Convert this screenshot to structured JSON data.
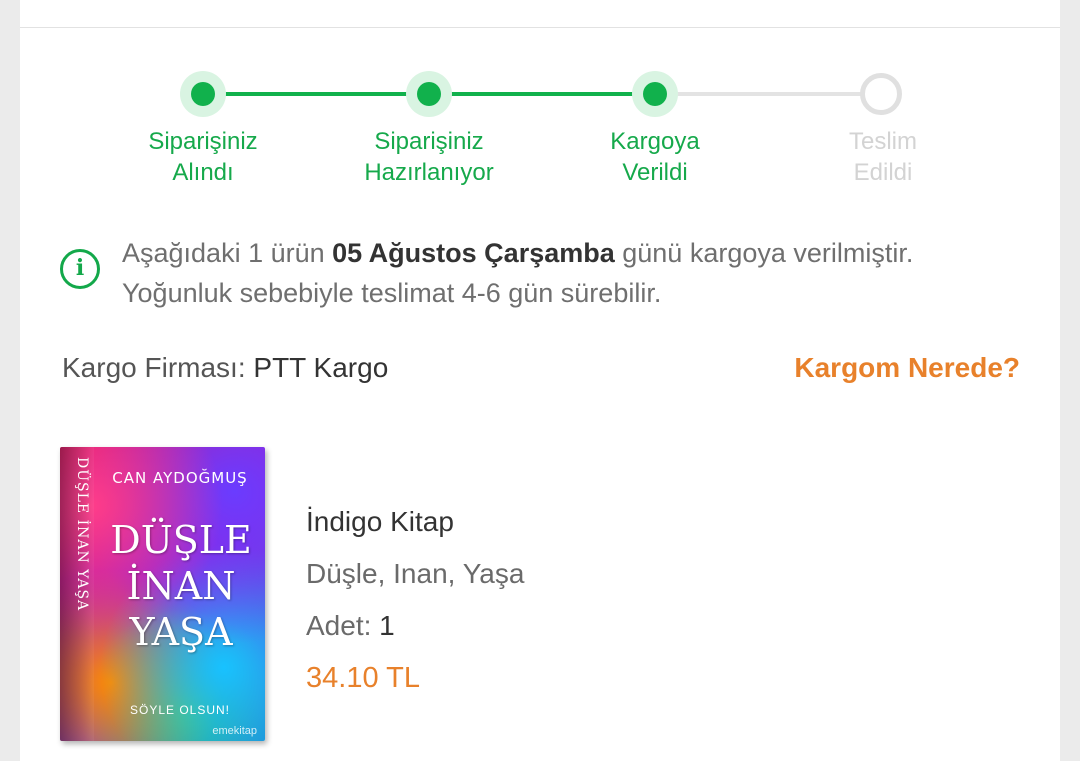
{
  "colors": {
    "accent_green": "#11b14c",
    "accent_orange": "#e8812b",
    "pending_gray": "#d3d3d3"
  },
  "progress": {
    "steps": [
      {
        "line1": "Siparişiniz",
        "line2": "Alındı",
        "status": "done"
      },
      {
        "line1": "Siparişiniz",
        "line2": "Hazırlanıyor",
        "status": "done"
      },
      {
        "line1": "Kargoya",
        "line2": "Verildi",
        "status": "done"
      },
      {
        "line1": "Teslim",
        "line2": "Edildi",
        "status": "pending"
      }
    ]
  },
  "info": {
    "icon": "info-icon",
    "icon_glyph": "i",
    "prefix": "Aşağıdaki 1 ürün ",
    "date": "05 Ağustos Çarşamba",
    "suffix": " günü kargoya verilmiştir.",
    "line2": "Yoğunluk sebebiyle teslimat 4-6 gün sürebilir."
  },
  "cargo": {
    "company_label": "Kargo Firması: ",
    "company_value": "PTT Kargo",
    "track_link": "Kargom Nerede?"
  },
  "book_cover": {
    "author": "CAN AYDOĞMUŞ",
    "title_line1": "DÜŞLE",
    "title_line2": "İNAN",
    "title_line3": "YAŞA",
    "spine": "DÜŞLE İNAN YAŞA",
    "footer": "SÖYLE OLSUN!",
    "publisher": "emekitap"
  },
  "product": {
    "publisher": "İndigo Kitap",
    "name": "Düşle, Inan, Yaşa",
    "qty_label": "Adet: ",
    "qty_value": "1",
    "price": "34.10 TL"
  }
}
